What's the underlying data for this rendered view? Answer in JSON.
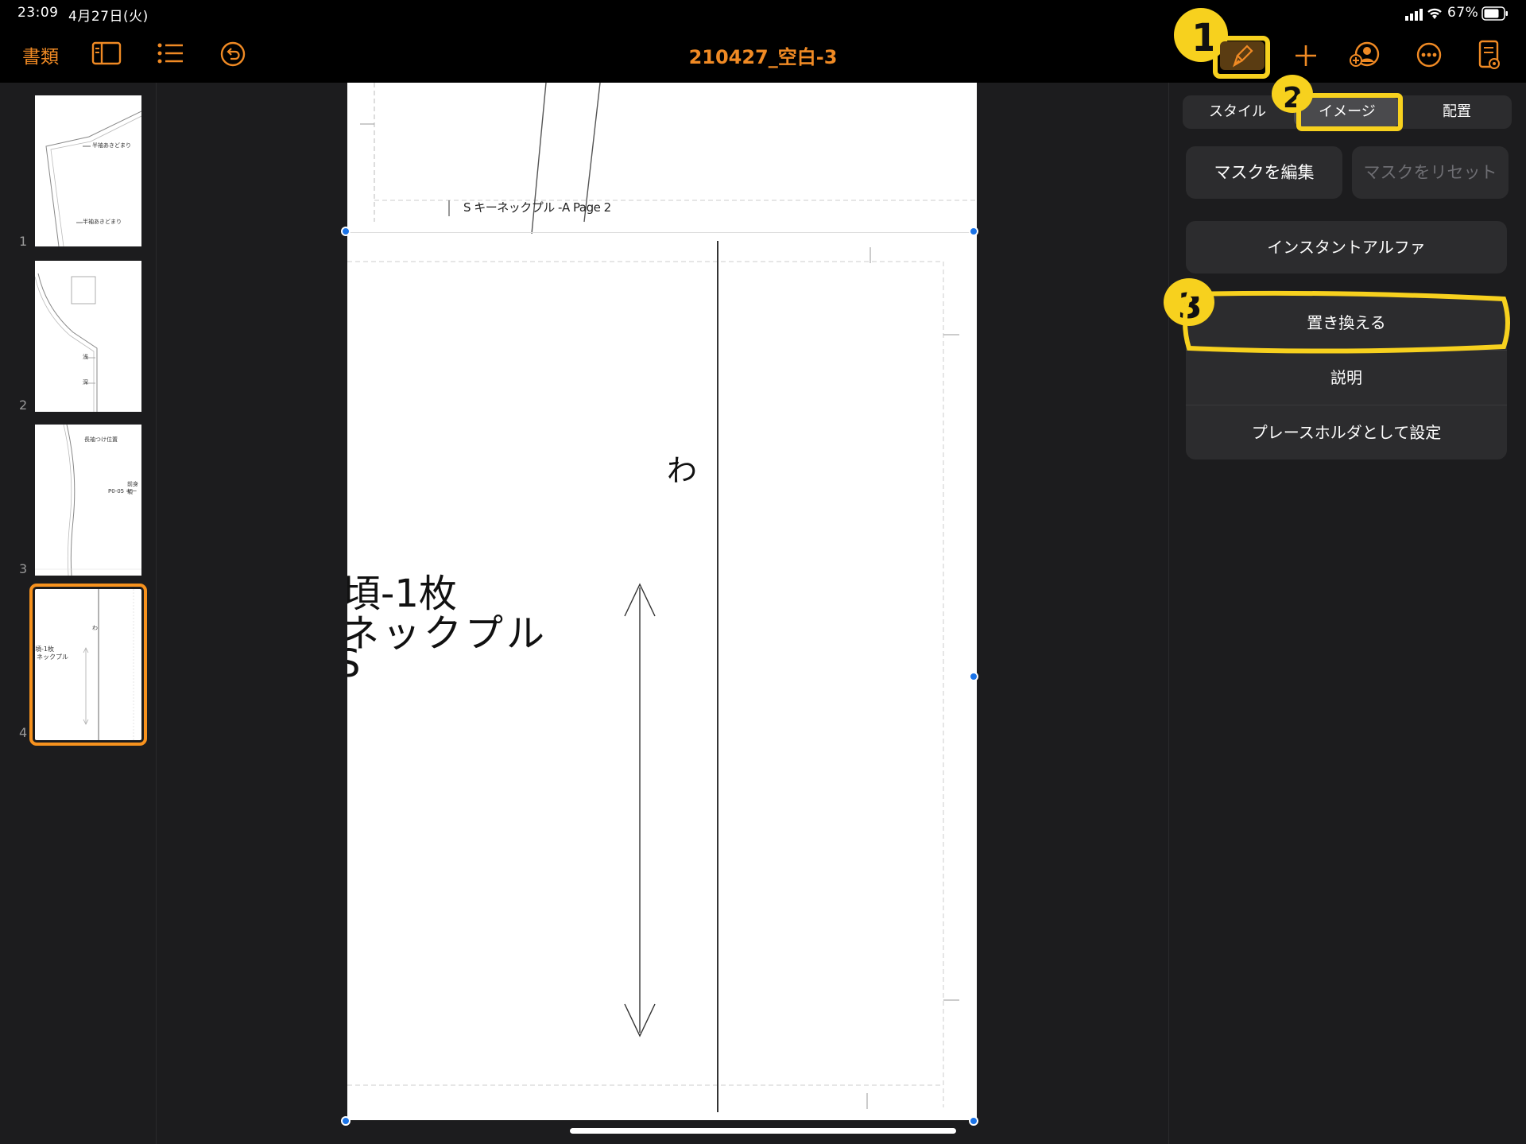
{
  "status_bar": {
    "time": "23:09",
    "date": "4月27日(火)",
    "battery": "67%"
  },
  "toolbar": {
    "documents_label": "書類",
    "title": "210427_空白-3",
    "icons": [
      "sidebar-icon",
      "list-icon",
      "undo-icon",
      "brush-icon",
      "plus-icon",
      "collaborate-icon",
      "more-icon",
      "document-view-icon"
    ]
  },
  "sidebar": {
    "pages": [
      {
        "number": "1",
        "texts": [
          "半袖あきどまり",
          "半袖あきどまり"
        ]
      },
      {
        "number": "2",
        "texts": [
          "浅",
          "深"
        ]
      },
      {
        "number": "3",
        "texts": [
          "長袖つけ位置",
          "前身頃",
          "P0-05 キー"
        ]
      },
      {
        "number": "4",
        "texts": [
          "わ",
          "頃-1枚",
          "ネックプル"
        ]
      }
    ],
    "selected_page": 4
  },
  "page_content": {
    "footer_label": "S キーネックプル -A Page 2",
    "fold_mark": "わ",
    "piece_line1": "頃-1枚",
    "piece_line2": "ネックプル",
    "piece_line3": "S"
  },
  "inspector": {
    "tabs": [
      {
        "label": "スタイル",
        "active": false
      },
      {
        "label": "イメージ",
        "active": true
      },
      {
        "label": "配置",
        "active": false
      }
    ],
    "edit_mask_label": "マスクを編集",
    "reset_mask_label": "マスクをリセット",
    "instant_alpha_label": "インスタントアルファ",
    "replace_label": "置き換える",
    "description_label": "説明",
    "placeholder_label": "プレースホルダとして設定"
  },
  "annotations": {
    "step1": "1",
    "step2": "2",
    "step3": "3",
    "highlight_color": "#f7d11e"
  },
  "colors": {
    "accent": "#f08a24",
    "selection": "#1a73e8",
    "background": "#1c1c1e"
  }
}
